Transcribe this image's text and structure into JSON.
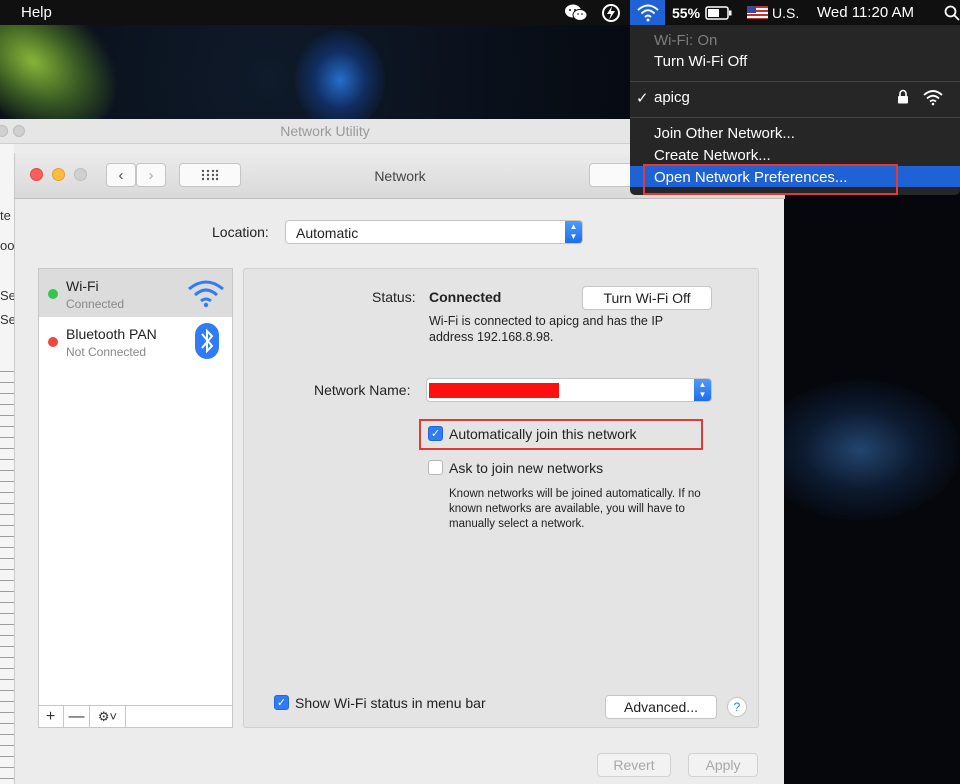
{
  "menubar": {
    "help": "Help",
    "battery": "55%",
    "input_source": "U.S.",
    "clock": "Wed 11:20 AM"
  },
  "wifi_menu": {
    "status": "Wi-Fi: On",
    "toggle": "Turn Wi-Fi Off",
    "current_network": "apicg",
    "join_other": "Join Other Network...",
    "create": "Create Network...",
    "open_prefs": "Open Network Preferences..."
  },
  "background_window": {
    "title": "Network Utility",
    "fragments": [
      "te",
      "oo",
      "Se",
      "Se"
    ]
  },
  "network_window": {
    "title": "Network",
    "location_label": "Location:",
    "location_value": "Automatic",
    "services": [
      {
        "name": "Wi-Fi",
        "status": "Connected",
        "dot": "#34c64a"
      },
      {
        "name": "Bluetooth PAN",
        "status": "Not Connected",
        "dot": "#f0463f"
      }
    ],
    "panel": {
      "status_label": "Status:",
      "status_value": "Connected",
      "turn_off": "Turn Wi-Fi Off",
      "status_desc": "Wi-Fi is connected to apicg and has the IP address 192.168.8.98.",
      "network_name_label": "Network Name:",
      "auto_join": "Automatically join this network",
      "ask_join": "Ask to join new networks",
      "ask_note": "Known networks will be joined automatically. If no known networks are available, you will have to manually select a network.",
      "show_status": "Show Wi-Fi status in menu bar",
      "advanced": "Advanced...",
      "help": "?"
    },
    "footer": {
      "revert": "Revert",
      "apply": "Apply"
    }
  },
  "colors": {
    "accent": "#2f7cf6",
    "menu_highlight": "#1f62d5",
    "highlight_box": "#e23b35"
  }
}
